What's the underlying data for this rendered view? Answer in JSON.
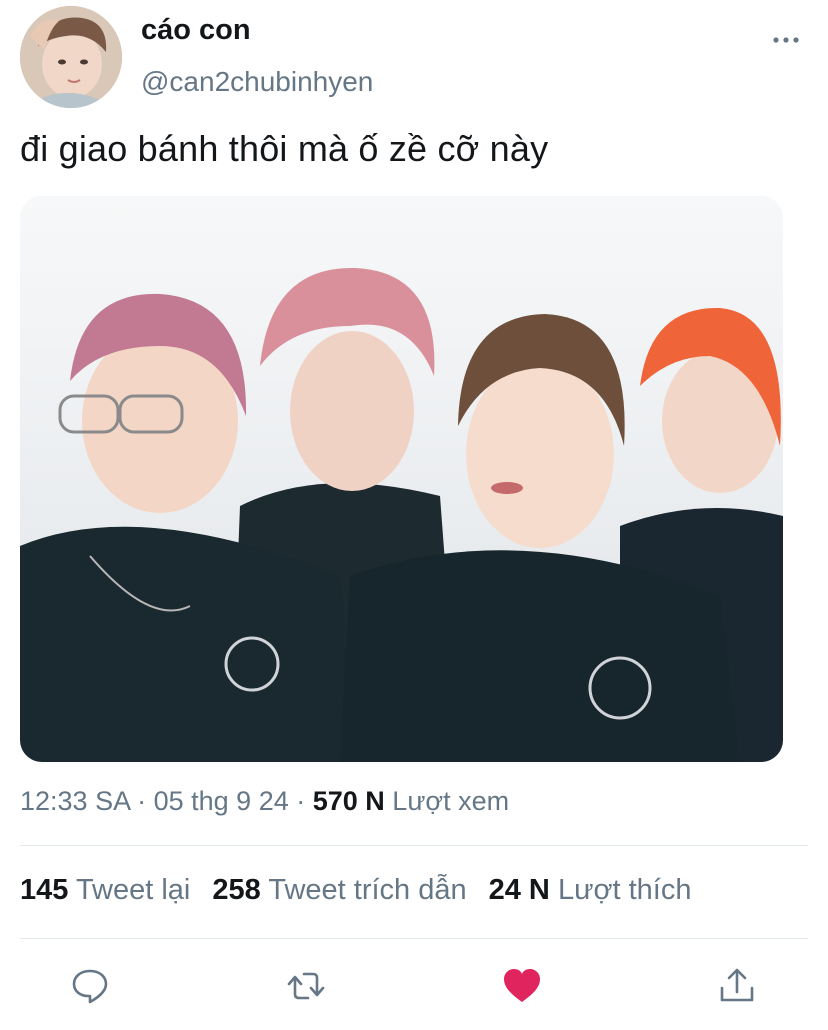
{
  "author": {
    "display_name": "cáo con",
    "handle": "@can2chubinhyen"
  },
  "tweet": {
    "text": "đi giao bánh thôi mà ố zề cỡ này"
  },
  "meta": {
    "time": "12:33 SA",
    "separator1": " · ",
    "date": "05 thg 9 24",
    "separator2": " · ",
    "views_count": "570 N",
    "views_label": " Lượt xem"
  },
  "stats": {
    "retweets_count": "145",
    "retweets_label": "Tweet lại",
    "quotes_count": "258",
    "quotes_label": "Tweet trích dẫn",
    "likes_count": "24 N",
    "likes_label": "Lượt thích"
  },
  "actions": {
    "reply_icon": "speech-bubble",
    "retweet_icon": "retweet-arrows",
    "like_icon": "heart-filled",
    "share_icon": "upload-arrow"
  },
  "colors": {
    "text_primary": "#14171a",
    "text_secondary": "#657786",
    "divider": "#e1e8ed",
    "like_active": "#e0245e"
  }
}
